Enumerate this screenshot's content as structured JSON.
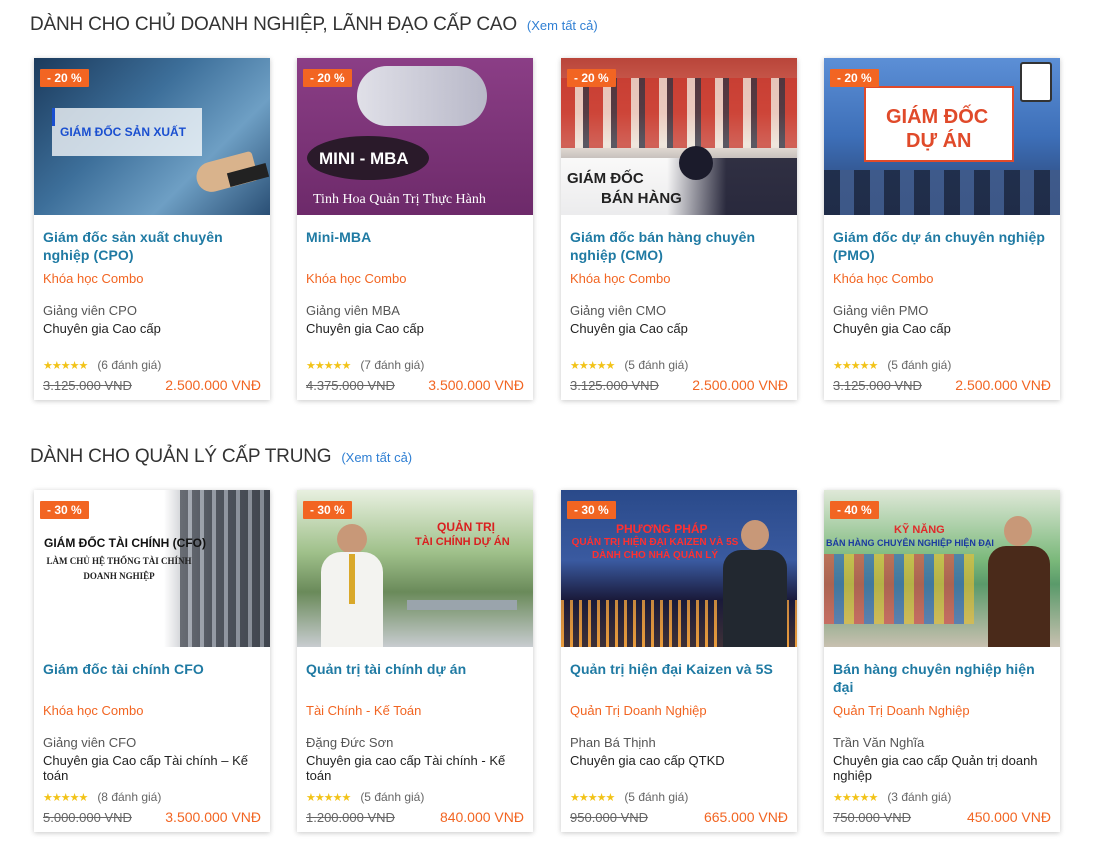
{
  "sections": [
    {
      "title": "DÀNH CHO CHỦ DOANH NGHIỆP, LÃNH ĐẠO CẤP CAO",
      "see_all": "(Xem tất cả)",
      "courses": [
        {
          "discount": "- 20 %",
          "image_text": "GIÁM ĐỐC SẢN XUẤT",
          "image_text_2": "",
          "title": "Giám đốc sản xuất chuyên nghiệp (CPO)",
          "category": "Khóa học Combo",
          "teacher": "Giảng viên CPO",
          "teacher_title": "Chuyên gia Cao cấp",
          "stars": "★★★★★",
          "reviews": "(6 đánh giá)",
          "old_price": "3.125.000 VNĐ",
          "new_price": "2.500.000 VNĐ"
        },
        {
          "discount": "- 20 %",
          "image_text": "MINI - MBA",
          "image_text_2": "Tinh Hoa Quản Trị Thực Hành",
          "title": "Mini-MBA",
          "category": "Khóa học Combo",
          "teacher": "Giảng viên MBA",
          "teacher_title": "Chuyên gia Cao cấp",
          "stars": "★★★★★",
          "reviews": "(7 đánh giá)",
          "old_price": "4.375.000 VNĐ",
          "new_price": "3.500.000 VNĐ"
        },
        {
          "discount": "- 20 %",
          "image_text": "GIÁM ĐỐC",
          "image_text_2": "BÁN HÀNG",
          "title": "Giám đốc bán hàng chuyên nghiệp (CMO)",
          "category": "Khóa học Combo",
          "teacher": "Giảng viên CMO",
          "teacher_title": "Chuyên gia Cao cấp",
          "stars": "★★★★★",
          "reviews": "(5 đánh giá)",
          "old_price": "3.125.000 VNĐ",
          "new_price": "2.500.000 VNĐ"
        },
        {
          "discount": "- 20 %",
          "image_text": "GIÁM ĐỐC",
          "image_text_2": "DỰ ÁN",
          "title": "Giám đốc dự án chuyên nghiệp (PMO)",
          "category": "Khóa học Combo",
          "teacher": "Giảng viên PMO",
          "teacher_title": "Chuyên gia Cao cấp",
          "stars": "★★★★★",
          "reviews": "(5 đánh giá)",
          "old_price": "3.125.000 VNĐ",
          "new_price": "2.500.000 VNĐ"
        }
      ]
    },
    {
      "title": "DÀNH CHO QUẢN LÝ CẤP TRUNG",
      "see_all": "(Xem tất cả)",
      "courses": [
        {
          "discount": "- 30 %",
          "image_text": "GIÁM ĐỐC TÀI CHÍNH (CFO)",
          "image_text_2": "LÀM CHỦ HỆ THỐNG TÀI CHÍNH DOANH NGHIỆP",
          "title": "Giám đốc tài chính CFO",
          "category": "Khóa học Combo",
          "teacher": "Giảng viên CFO",
          "teacher_title": "Chuyên gia Cao cấp Tài chính – Kế toán",
          "stars": "★★★★★",
          "reviews": "(8 đánh giá)",
          "old_price": "5.000.000 VNĐ",
          "new_price": "3.500.000 VNĐ"
        },
        {
          "discount": "- 30 %",
          "image_text": "QUẢN TRỊ",
          "image_text_2": "TÀI CHÍNH DỰ ÁN",
          "title": "Quản trị tài chính dự án",
          "category": "Tài Chính - Kế Toán",
          "teacher": "Đặng Đức Sơn",
          "teacher_title": "Chuyên gia cao cấp Tài chính - Kế toán",
          "stars": "★★★★★",
          "reviews": "(5 đánh giá)",
          "old_price": "1.200.000 VNĐ",
          "new_price": "840.000 VNĐ"
        },
        {
          "discount": "- 30 %",
          "image_text": "PHƯƠNG PHÁP",
          "image_text_2": "QUẢN TRỊ HIỆN ĐẠI KAIZEN VÀ 5S DÀNH CHO NHÀ QUẢN LÝ",
          "title": "Quản trị hiện đại Kaizen và 5S",
          "category": "Quản Trị Doanh Nghiệp",
          "teacher": "Phan Bá Thịnh",
          "teacher_title": "Chuyên gia cao cấp QTKD",
          "stars": "★★★★★",
          "reviews": "(5 đánh giá)",
          "old_price": "950.000 VNĐ",
          "new_price": "665.000 VNĐ"
        },
        {
          "discount": "- 40 %",
          "image_text": "KỸ NĂNG",
          "image_text_2": "BÁN HÀNG CHUYÊN NGHIỆP HIỆN ĐẠI",
          "title": "Bán hàng chuyên nghiệp hiện đại",
          "category": "Quản Trị Doanh Nghiệp",
          "teacher": "Trần Văn Nghĩa",
          "teacher_title": "Chuyên gia cao cấp Quản trị doanh nghiệp",
          "stars": "★★★★★",
          "reviews": "(3 đánh giá)",
          "old_price": "750.000 VNĐ",
          "new_price": "450.000 VNĐ"
        }
      ]
    }
  ]
}
